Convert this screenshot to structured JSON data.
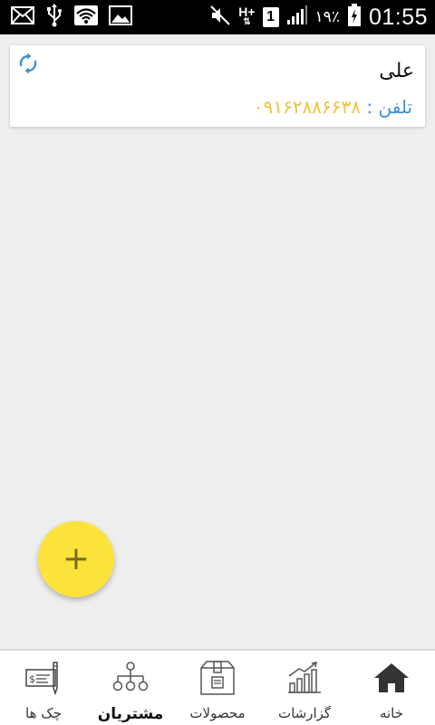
{
  "status_bar": {
    "battery_percent": "۱۹٪",
    "time": "01:55",
    "sim_slot": "1",
    "network_type": "H+",
    "icons": [
      "mail-icon",
      "usb-icon",
      "wifi-icon",
      "image-icon",
      "mute-icon",
      "signal-icon",
      "battery-icon"
    ]
  },
  "customer": {
    "name": "علی",
    "phone_label": "تلفن :",
    "phone_value": "۰۹۱۶۲۸۸۶۶۳۸"
  },
  "fab": {
    "symbol": "+"
  },
  "bottom_nav": {
    "items": [
      {
        "label": "خانه",
        "icon": "home-icon"
      },
      {
        "label": "گزارشات",
        "icon": "chart-icon"
      },
      {
        "label": "محصولات",
        "icon": "box-icon"
      },
      {
        "label": "مشتریان",
        "icon": "hierarchy-icon",
        "active": true
      },
      {
        "label": "چک ها",
        "icon": "cheque-icon"
      }
    ]
  },
  "colors": {
    "accent_yellow": "#fbe33b",
    "phone_label_blue": "#3f8fd6",
    "phone_value_yellow": "#f0c23a",
    "refresh_blue": "#3f8fd6"
  }
}
